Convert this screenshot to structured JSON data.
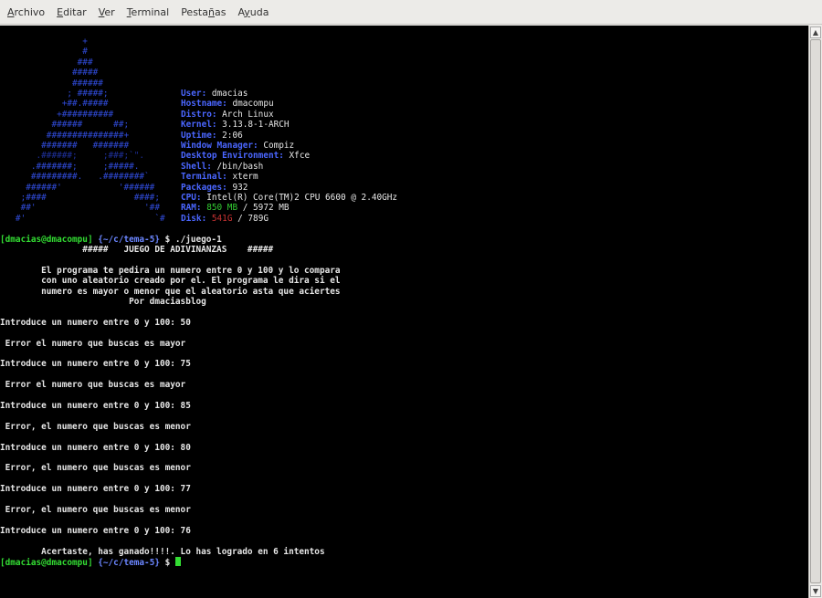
{
  "menu": [
    {
      "pre": "",
      "acc": "A",
      "post": "rchivo"
    },
    {
      "pre": "",
      "acc": "E",
      "post": "ditar"
    },
    {
      "pre": "",
      "acc": "V",
      "post": "er"
    },
    {
      "pre": "",
      "acc": "T",
      "post": "erminal"
    },
    {
      "pre": "Pesta",
      "acc": "ñ",
      "post": "as"
    },
    {
      "pre": "A",
      "acc": "y",
      "post": "uda"
    }
  ],
  "logo": [
    "                +",
    "                #",
    "               ###",
    "              #####",
    "              ######",
    "             ; #####;",
    "            +##.#####",
    "           +##########",
    "          ######      ##;",
    "         ###############+",
    "        #######   #######",
    "       .######;     ;###;`\".",
    "      .#######;     ;#####.",
    "      #########.   .########`",
    "     ######'           '######",
    "    ;####                 ####;",
    "    ##'                     '##",
    "   #'                         `#"
  ],
  "sysinfo": [
    {
      "key": "User:",
      "val": " dmacias"
    },
    {
      "key": "Hostname:",
      "val": " dmacompu"
    },
    {
      "key": "Distro:",
      "val": " Arch Linux"
    },
    {
      "key": "Kernel:",
      "val": " 3.13.8-1-ARCH"
    },
    {
      "key": "Uptime:",
      "val": " 2:06"
    },
    {
      "key": "Window Manager:",
      "val": " Compiz"
    },
    {
      "key": "Desktop Environment:",
      "val": " Xfce"
    },
    {
      "key": "Shell:",
      "val": " /bin/bash"
    },
    {
      "key": "Terminal:",
      "val": " xterm"
    },
    {
      "key": "Packages:",
      "val": " 932"
    },
    {
      "key": "CPU:",
      "val": " Intel(R) Core(TM)2 CPU 6600 @ 2.40GHz"
    }
  ],
  "ram": {
    "key": "RAM:",
    "used": "850 MB",
    "total": " / 5972 MB"
  },
  "disk": {
    "key": "Disk:",
    "used": "541G",
    "total": " / 789G"
  },
  "prompt": {
    "user": "[dmacias@dmacompu]",
    "path": " {~/c/tema-5}",
    "sym": " $",
    "command": " ./juego-1"
  },
  "header": "                #####   JUEGO DE ADIVINANZAS    #####",
  "intro": [
    "        El programa te pedira un numero entre 0 y 100 y lo compara",
    "        con uno aleatorio creado por el. El programa le dira si el",
    "        numero es mayor o menor que el aleatorio asta que aciertes",
    "                         Por dmaciasblog"
  ],
  "game": [
    "Introduce un numero entre 0 y 100: 50",
    " Error el numero que buscas es mayor",
    "Introduce un numero entre 0 y 100: 75",
    " Error el numero que buscas es mayor",
    "Introduce un numero entre 0 y 100: 85",
    " Error, el numero que buscas es menor",
    "Introduce un numero entre 0 y 100: 80",
    " Error, el numero que buscas es menor",
    "Introduce un numero entre 0 y 100: 77",
    " Error, el numero que buscas es menor",
    "Introduce un numero entre 0 y 100: 76"
  ],
  "win": "        Acertaste, has ganado!!!!. Lo has logrado en 6 intentos",
  "scroll": {
    "up": "▲",
    "down": "▼"
  }
}
